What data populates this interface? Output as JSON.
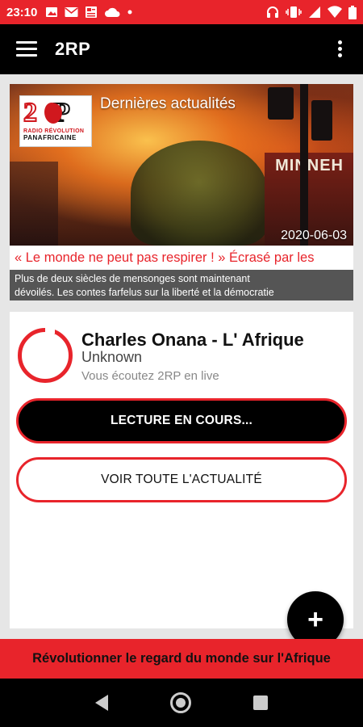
{
  "status_bar": {
    "time": "23:10",
    "left_icons": [
      "image-icon",
      "mail-icon",
      "news-icon",
      "cloud-icon",
      "dot-icon"
    ],
    "right_icons": [
      "headset-icon",
      "vibrate-icon",
      "signal-icon",
      "wifi-icon",
      "battery-icon"
    ],
    "color": "#e8242b"
  },
  "app_bar": {
    "title": "2RP"
  },
  "news": {
    "heading": "Dernières actualités",
    "date": "2020-06-03",
    "headline": "« Le monde ne peut pas respirer ! » Écrasé par les",
    "description_line1": "Plus de deux siècles de mensonges sont maintenant",
    "description_line2": "dévoilés. Les contes farfelus sur la liberté et la démocratie",
    "image_sign": "MINNEH",
    "logo": {
      "mark": "2RP",
      "line1": "RADIO RÉVOLUTION",
      "line2": "PANAFRICAINE"
    }
  },
  "player": {
    "title": "Charles Onana - L' Afrique",
    "artist": "Unknown",
    "status": "Vous écoutez 2RP en live",
    "playing_button": "LECTURE EN COURS...",
    "news_button": "VOIR TOUTE L'ACTUALITÉ"
  },
  "fab": {
    "icon": "plus-icon",
    "label": "+"
  },
  "banner": {
    "text": "Révolutionner le regard du monde sur l'Afrique"
  },
  "colors": {
    "accent": "#e8242b",
    "dark": "#000000"
  }
}
